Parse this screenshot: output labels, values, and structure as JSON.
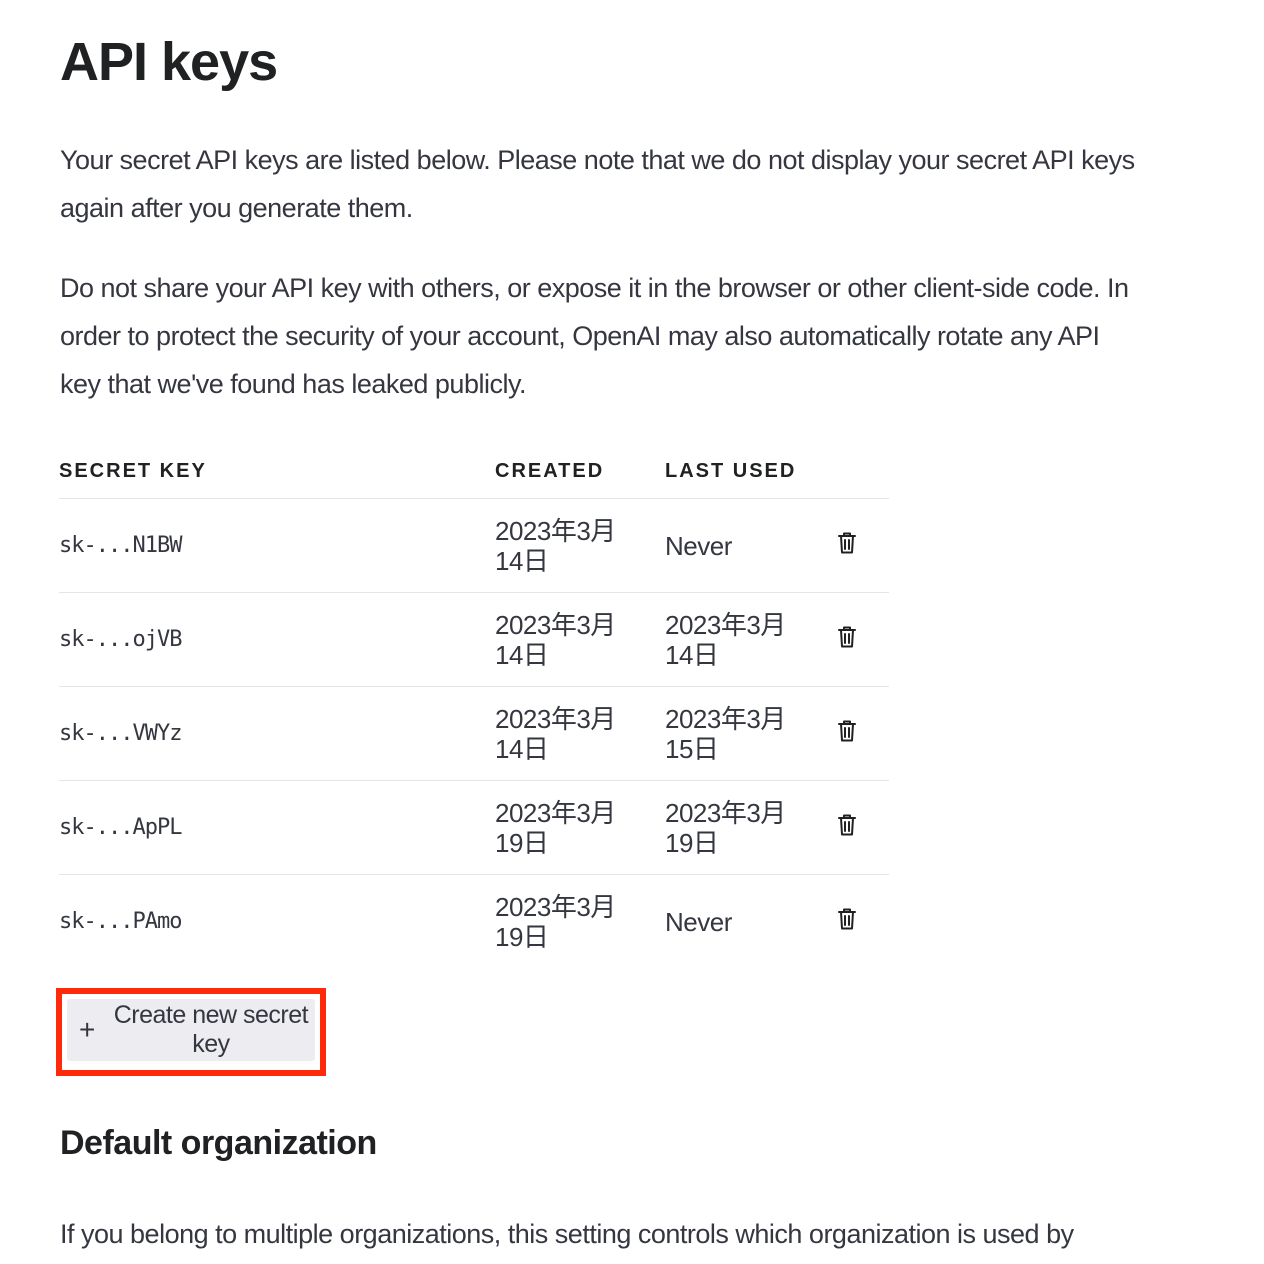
{
  "page": {
    "title": "API keys",
    "intro_1": "Your secret API keys are listed below. Please note that we do not display your secret API keys again after you generate them.",
    "intro_2": "Do not share your API key with others, or expose it in the browser or other client-side code. In order to protect the security of your account, OpenAI may also automatically rotate any API key that we've found has leaked publicly."
  },
  "table": {
    "headers": {
      "secret_key": "SECRET KEY",
      "created": "CREATED",
      "last_used": "LAST USED"
    },
    "rows": [
      {
        "key": "sk-...N1BW",
        "created": "2023年3月14日",
        "last_used": "Never"
      },
      {
        "key": "sk-...ojVB",
        "created": "2023年3月14日",
        "last_used": "2023年3月14日"
      },
      {
        "key": "sk-...VWYz",
        "created": "2023年3月14日",
        "last_used": "2023年3月15日"
      },
      {
        "key": "sk-...ApPL",
        "created": "2023年3月19日",
        "last_used": "2023年3月19日"
      },
      {
        "key": "sk-...PAmo",
        "created": "2023年3月19日",
        "last_used": "Never"
      }
    ]
  },
  "create_button": {
    "icon": "plus-icon",
    "label": "Create new secret key",
    "highlight_color": "#ff2a0a"
  },
  "default_org": {
    "title": "Default organization",
    "description": "If you belong to multiple organizations, this setting controls which organization is used by default"
  },
  "icons": {
    "row_action": "trash-icon"
  }
}
